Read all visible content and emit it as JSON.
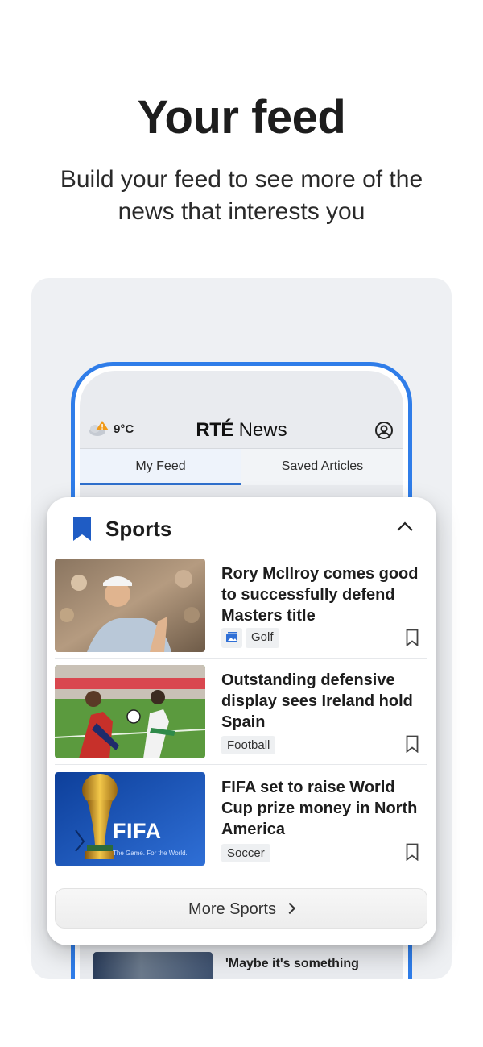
{
  "promo": {
    "title": "Your feed",
    "subtitle": "Build your feed to see more of the news that interests you"
  },
  "app": {
    "temperature": "9°C",
    "logo_brand": "RTÉ",
    "logo_word": "News",
    "tabs": [
      {
        "label": "My Feed",
        "active": true
      },
      {
        "label": "Saved Articles",
        "active": false
      }
    ],
    "behind_headline": "'Maybe it's something"
  },
  "card": {
    "title": "Sports",
    "articles": [
      {
        "headline": "Rory McIlroy comes good to successfully defend Masters title",
        "tag": "Golf",
        "has_gallery": true
      },
      {
        "headline": "Outstanding defensive display sees Ireland hold Spain",
        "tag": "Football",
        "has_gallery": false
      },
      {
        "headline": "FIFA set to raise World Cup prize money in North America",
        "tag": "Soccer",
        "has_gallery": false
      }
    ],
    "fifa_thumb_text": "FIFA",
    "fifa_thumb_sub": "The Game. For the World.",
    "more_label": "More Sports"
  },
  "colors": {
    "accent": "#2f7de9",
    "bookmark": "#1f5cc4"
  }
}
